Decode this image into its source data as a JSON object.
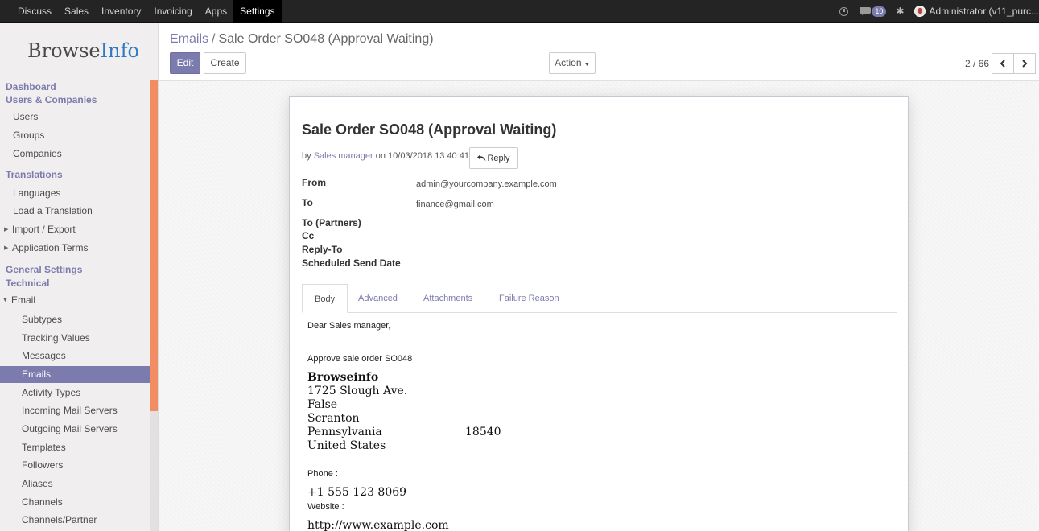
{
  "topbar": {
    "menu": [
      "Discuss",
      "Sales",
      "Inventory",
      "Invoicing",
      "Apps",
      "Settings"
    ],
    "active": "Settings",
    "notification_count": "10",
    "user": "Administrator (v11_purc..."
  },
  "sidebar": {
    "logo_part1": "Browse",
    "logo_part2": "Info",
    "items": [
      {
        "label": "Dashboard",
        "type": "head"
      },
      {
        "label": "Users & Companies",
        "type": "head"
      },
      {
        "label": "Users",
        "type": "item"
      },
      {
        "label": "Groups",
        "type": "item"
      },
      {
        "label": "Companies",
        "type": "item"
      },
      {
        "label": "Translations",
        "type": "head"
      },
      {
        "label": "Languages",
        "type": "item"
      },
      {
        "label": "Load a Translation",
        "type": "item"
      },
      {
        "label": "Import / Export",
        "type": "item"
      },
      {
        "label": "Application Terms",
        "type": "item"
      },
      {
        "label": "General Settings",
        "type": "head"
      },
      {
        "label": "Technical",
        "type": "head"
      },
      {
        "label": "Email",
        "type": "item"
      },
      {
        "label": "Subtypes",
        "type": "sub"
      },
      {
        "label": "Tracking Values",
        "type": "sub"
      },
      {
        "label": "Messages",
        "type": "sub"
      },
      {
        "label": "Emails",
        "type": "sub",
        "active": true
      },
      {
        "label": "Activity Types",
        "type": "sub"
      },
      {
        "label": "Incoming Mail Servers",
        "type": "sub"
      },
      {
        "label": "Outgoing Mail Servers",
        "type": "sub"
      },
      {
        "label": "Templates",
        "type": "sub"
      },
      {
        "label": "Followers",
        "type": "sub"
      },
      {
        "label": "Aliases",
        "type": "sub"
      },
      {
        "label": "Channels",
        "type": "sub"
      },
      {
        "label": "Channels/Partner",
        "type": "sub"
      }
    ]
  },
  "breadcrumb": {
    "parent": "Emails",
    "separator": "/",
    "current": "Sale Order SO048 (Approval Waiting)"
  },
  "buttons": {
    "edit": "Edit",
    "create": "Create",
    "action": "Action"
  },
  "pager": {
    "value": "2 / 66"
  },
  "email": {
    "subject": "Sale Order SO048 (Approval Waiting)",
    "by_prefix": "by",
    "author": "Sales manager",
    "date_text": "on 10/03/2018 13:40:41",
    "reply_label": "Reply",
    "fields": {
      "from_label": "From",
      "from_value": "admin@yourcompany.example.com",
      "to_label": "To",
      "to_value": "finance@gmail.com",
      "to_partners_label": "To (Partners)",
      "cc_label": "Cc",
      "reply_to_label": "Reply-To",
      "scheduled_label": "Scheduled Send Date"
    },
    "tabs": [
      "Body",
      "Advanced",
      "Attachments",
      "Failure Reason"
    ],
    "active_tab": "Body",
    "body": {
      "greeting": "Dear Sales manager,",
      "line1": "Approve sale order SO048",
      "company": "Browseinfo",
      "address1": "1725 Slough Ave.",
      "address2": "False",
      "city": "Scranton",
      "state": "Pennsylvania",
      "zip": "18540",
      "country": "United States",
      "phone_label": "Phone :",
      "phone": "+1 555 123 8069",
      "website_label": "Website :",
      "website": "http://www.example.com"
    }
  }
}
